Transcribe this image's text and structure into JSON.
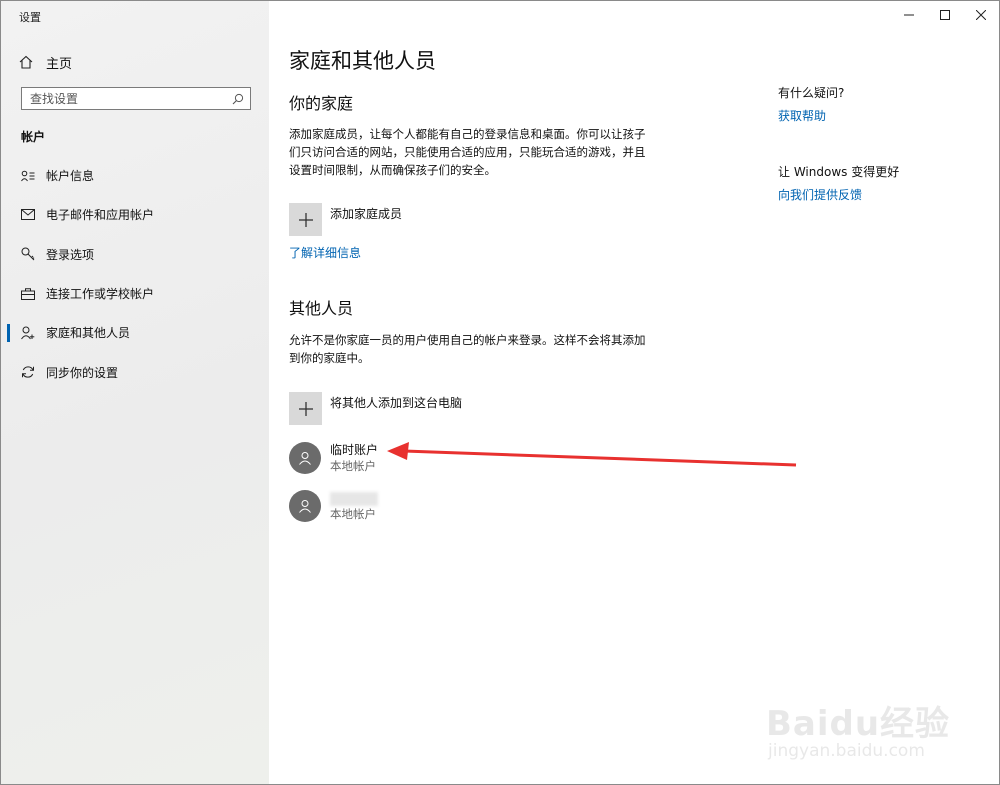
{
  "window": {
    "title": "设置"
  },
  "sidebar": {
    "home_label": "主页",
    "search_placeholder": "查找设置",
    "section": "帐户",
    "items": [
      {
        "label": "帐户信息",
        "icon": "account-info-icon"
      },
      {
        "label": "电子邮件和应用帐户",
        "icon": "mail-icon"
      },
      {
        "label": "登录选项",
        "icon": "key-icon"
      },
      {
        "label": "连接工作或学校帐户",
        "icon": "briefcase-icon"
      },
      {
        "label": "家庭和其他人员",
        "icon": "person-add-icon",
        "active": true
      },
      {
        "label": "同步你的设置",
        "icon": "sync-icon"
      }
    ]
  },
  "main": {
    "title": "家庭和其他人员",
    "family": {
      "heading": "你的家庭",
      "description": "添加家庭成员，让每个人都能有自己的登录信息和桌面。你可以让孩子们只访问合适的网站，只能使用合适的应用，只能玩合适的游戏，并且设置时间限制，从而确保孩子们的安全。",
      "add_label": "添加家庭成员",
      "learn_more": "了解详细信息"
    },
    "others": {
      "heading": "其他人员",
      "description": "允许不是你家庭一员的用户使用自己的帐户来登录。这样不会将其添加到你的家庭中。",
      "add_label": "将其他人添加到这台电脑",
      "accounts": [
        {
          "name": "临时账户",
          "type": "本地帐户"
        },
        {
          "name": "",
          "type": "本地帐户"
        }
      ]
    },
    "aside": {
      "question": "有什么疑问?",
      "help_link": "获取帮助",
      "improve": "让 Windows 变得更好",
      "feedback_link": "向我们提供反馈"
    }
  },
  "watermark": {
    "brand": "Baidu经验",
    "url": "jingyan.baidu.com"
  },
  "colors": {
    "accent": "#0063b1",
    "arrow": "#e8312f",
    "avatar": "#6b6b6b"
  }
}
